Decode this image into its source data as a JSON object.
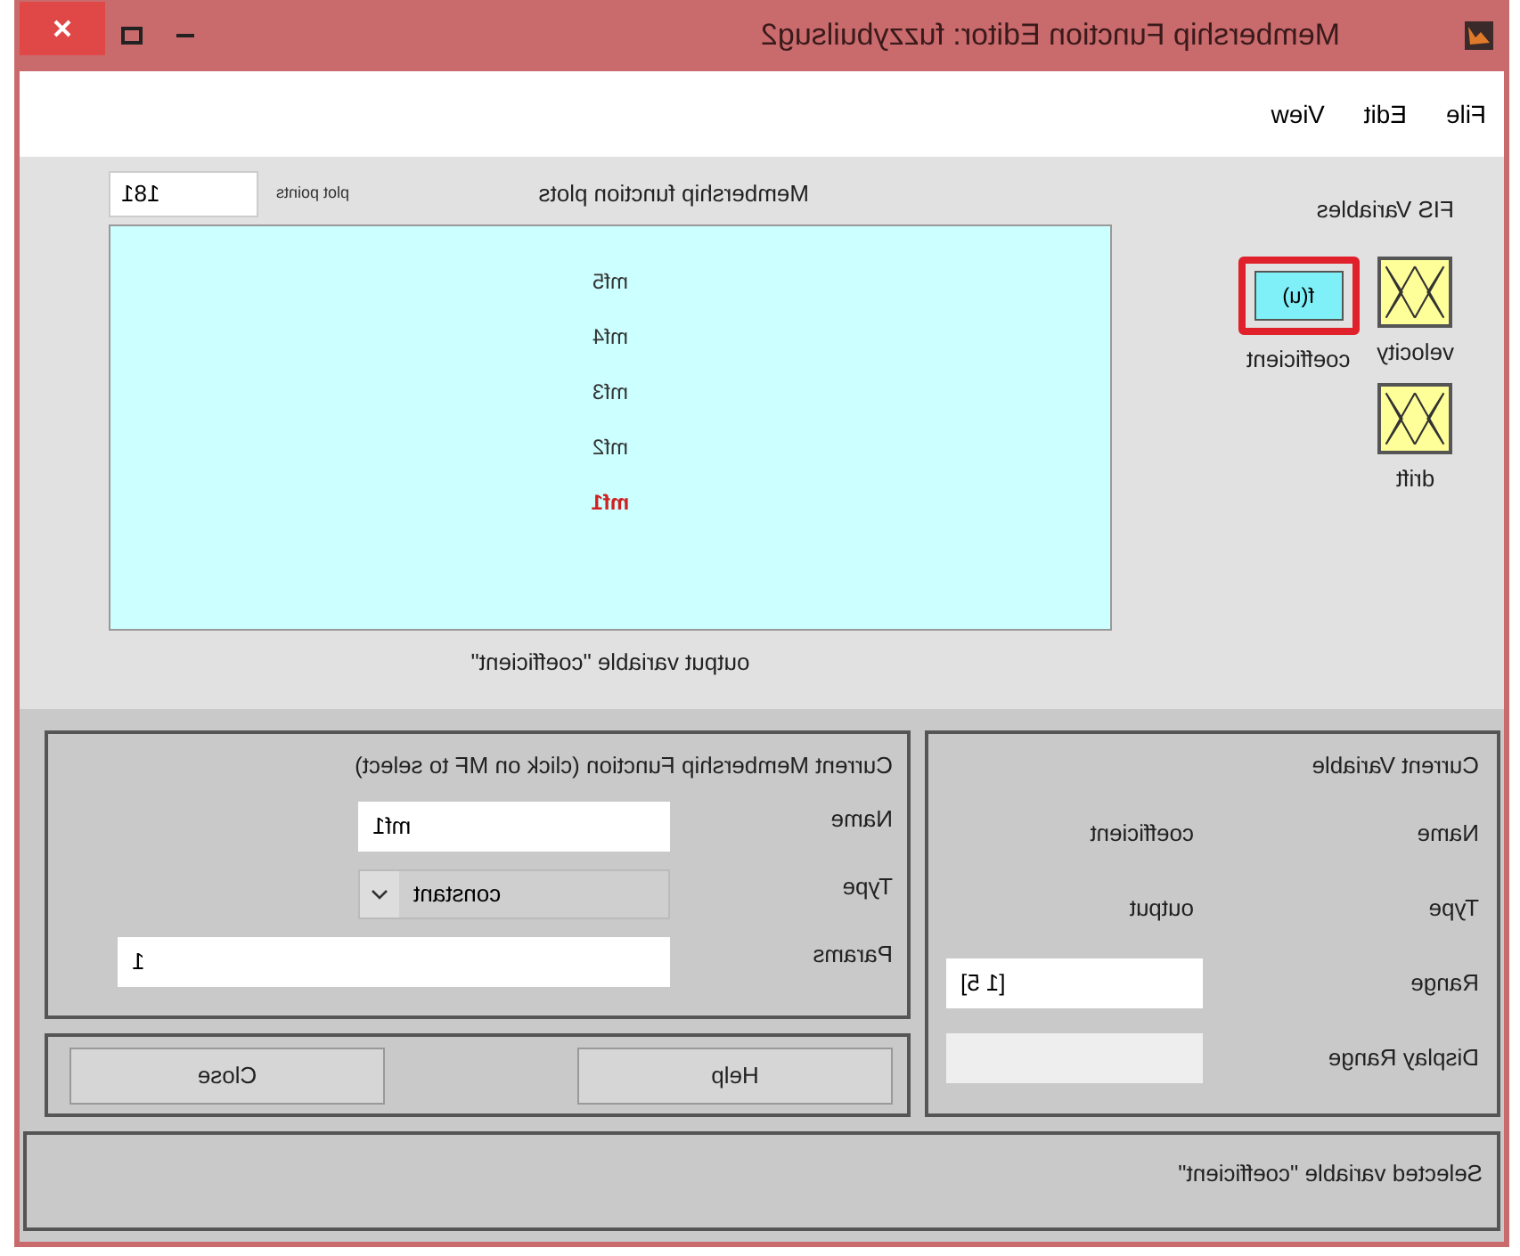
{
  "window": {
    "title": "Membership Function Editor: fuzzybuilsug2"
  },
  "menu": [
    "View",
    "Edit",
    "File"
  ],
  "fis_variables": {
    "title": "FIS Variables",
    "items": [
      {
        "label": "velocity",
        "kind": "input",
        "selected": false
      },
      {
        "label": "coefficient",
        "kind": "output",
        "text": "f(u)",
        "selected": true
      },
      {
        "label": "drift",
        "kind": "input",
        "selected": false
      }
    ]
  },
  "plot": {
    "title": "Membership function plots",
    "points_label": "plot points",
    "points": "181",
    "caption": "output variable \"coefficient\"",
    "mfs": [
      {
        "label": "mf5",
        "selected": false
      },
      {
        "label": "mf4",
        "selected": false
      },
      {
        "label": "mf3",
        "selected": false
      },
      {
        "label": "mf2",
        "selected": false
      },
      {
        "label": "mf1",
        "selected": true
      }
    ]
  },
  "current_variable": {
    "title": "Current Variable",
    "rows": [
      {
        "label": "Name",
        "kind": "text",
        "value": "coefficient"
      },
      {
        "label": "Type",
        "kind": "text",
        "value": "output"
      },
      {
        "label": "Range",
        "kind": "field",
        "value": "[1 5]"
      },
      {
        "label": "Display Range",
        "kind": "disabled-field"
      }
    ]
  },
  "current_mf": {
    "title": "Current Membership Function (click on MF to select)",
    "rows": [
      {
        "label": "Name",
        "kind": "field",
        "value": "mf1"
      },
      {
        "label": "Type",
        "kind": "dropdown",
        "value": "constant"
      },
      {
        "label": "Params",
        "kind": "wide-field",
        "value": "1"
      }
    ]
  },
  "buttons": [
    "Close",
    "Help"
  ],
  "status": "Selected variable \"coefficient\""
}
